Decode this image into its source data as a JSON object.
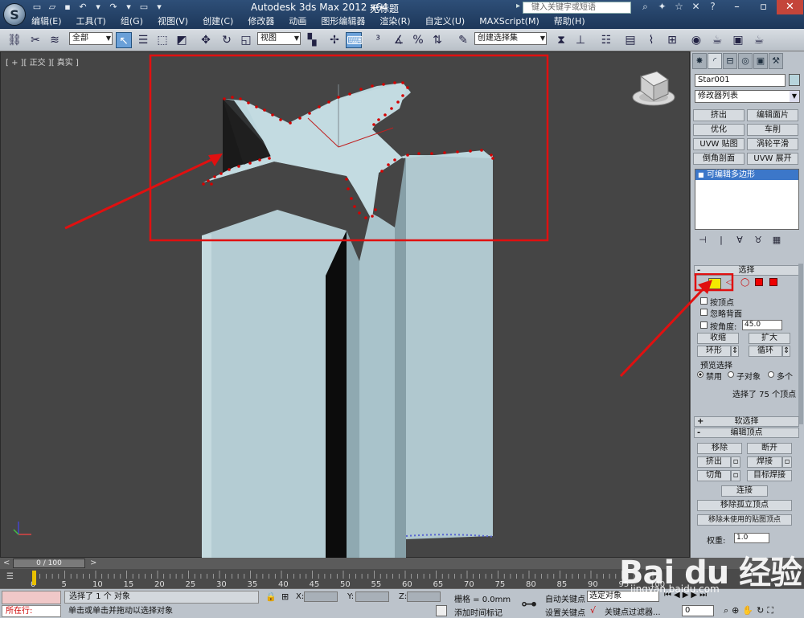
{
  "window": {
    "app_title": "Autodesk 3ds Max  2012 x64",
    "doc_title": "无标题",
    "search_placeholder": "键入关键字或短语"
  },
  "menu": [
    "编辑(E)",
    "工具(T)",
    "组(G)",
    "视图(V)",
    "创建(C)",
    "修改器",
    "动画",
    "图形编辑器",
    "渲染(R)",
    "自定义(U)",
    "MAXScript(M)",
    "帮助(H)"
  ],
  "toolbar": {
    "selection_filter": "全部",
    "ref_coord": "视图",
    "named_selection": "创建选择集"
  },
  "viewport": {
    "label": "[ + ][ 正交 ][ 真实 ]"
  },
  "command_panel": {
    "object_name": "Star001",
    "modifier_list": "修改器列表",
    "modifier_buttons": [
      "挤出",
      "编辑面片",
      "优化",
      "车削",
      "UVW 贴图",
      "涡轮平滑",
      "倒角剖面",
      "UVW 展开"
    ],
    "stack_item": "可编辑多边形",
    "selection_rollout": {
      "title": "选择",
      "by_vertex": "按顶点",
      "ignore_backfacing": "忽略背面",
      "by_angle": "按角度:",
      "angle_value": "45.0",
      "shrink": "收缩",
      "grow": "扩大",
      "ring": "环形",
      "loop": "循环",
      "preview_title": "预览选择",
      "preview_disabled": "禁用",
      "preview_subobject": "子对象",
      "preview_multiple": "多个",
      "selected_info": "选择了 75 个顶点"
    },
    "soft_selection_title": "软选择",
    "edit_vertices": {
      "title": "编辑顶点",
      "remove": "移除",
      "break": "断开",
      "extrude": "挤出",
      "weld": "焊接",
      "chamfer": "切角",
      "target_weld": "目标焊接",
      "connect": "连接",
      "remove_isolated": "移除孤立顶点",
      "remove_unused_map": "移除未使用的贴图顶点",
      "weight_label": "权重:",
      "weight_value": "1.0"
    }
  },
  "timeline": {
    "slider": "0 / 100",
    "ticks": [
      "0",
      "5",
      "10",
      "15",
      "20",
      "25",
      "30",
      "35",
      "40",
      "45",
      "50",
      "55",
      "60",
      "65",
      "70",
      "75",
      "80",
      "85",
      "90",
      "95",
      "100"
    ]
  },
  "status": {
    "current_cmd": "所在行:",
    "selected": "选择了 1 个 对象",
    "prompt": "单击或单击并拖动以选择对象",
    "x_label": "X:",
    "y_label": "Y:",
    "z_label": "Z:",
    "grid": "栅格 = 0.0mm",
    "add_time_tag": "添加时间标记",
    "auto_key": "自动关键点",
    "set_key": "设置关键点",
    "selected_set": "选定对象",
    "key_filters": "关键点过滤器...",
    "frame": "0"
  },
  "watermark": {
    "logo": "Bai du 经验",
    "url": "jingyan.baidu.com"
  },
  "colors": {
    "title_bar": "#2e4f78",
    "annotation_red": "#e01010",
    "object_face": "#b7cfd6",
    "vertex_red": "#d40000",
    "active_subobject": "#f4e800"
  }
}
